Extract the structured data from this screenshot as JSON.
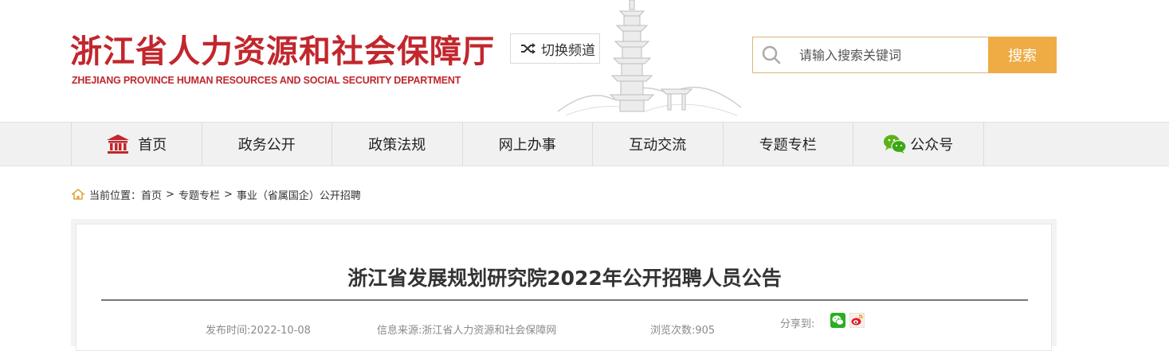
{
  "header": {
    "logo_cn": "浙江省人力资源和社会保障厅",
    "logo_en": "ZHEJIANG PROVINCE HUMAN RESOURCES AND SOCIAL SECURITY DEPARTMENT",
    "switch_label": "切换频道",
    "search": {
      "placeholder": "请输入搜索关键词",
      "button": "搜索"
    }
  },
  "nav": {
    "items": [
      {
        "label": "首页",
        "icon": "home-building-icon"
      },
      {
        "label": "政务公开"
      },
      {
        "label": "政策法规"
      },
      {
        "label": "网上办事"
      },
      {
        "label": "互动交流"
      },
      {
        "label": "专题专栏"
      },
      {
        "label": "公众号",
        "icon": "wechat-icon"
      }
    ]
  },
  "breadcrumb": {
    "prefix": "当前位置：",
    "items": [
      "首页",
      "专题专栏",
      "事业（省属国企）公开招聘"
    ],
    "separator": ">"
  },
  "article": {
    "title": "浙江省发展规划研究院2022年公开招聘人员公告",
    "publish_time": "发布时间:2022-10-08",
    "source": "信息来源:浙江省人力资源和社会保障网",
    "views": "浏览次数:905",
    "share_label": "分享到:",
    "share_icons": [
      "wechat-share-icon",
      "weibo-share-icon"
    ]
  },
  "colors": {
    "brand_red": "#c1272d",
    "search_button": "#efac44",
    "nav_bg": "#f1f1f1"
  }
}
